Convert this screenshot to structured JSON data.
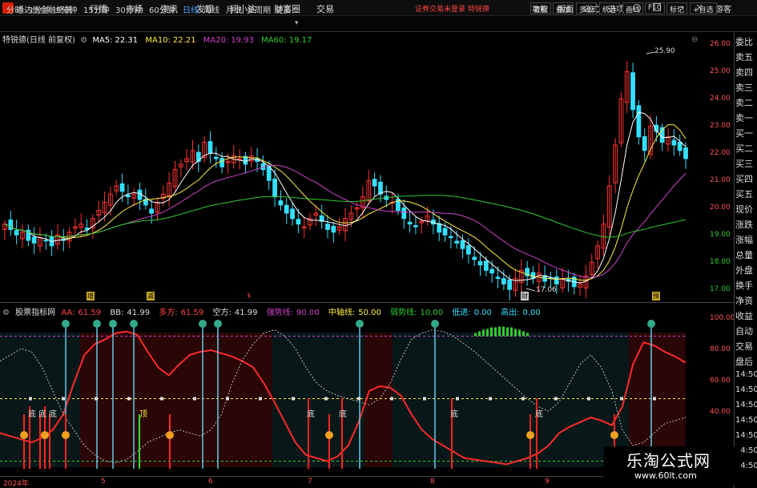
{
  "titlebar": {
    "app_name": "通达信金融终端",
    "menus": [
      "行情",
      "市场",
      "资讯",
      "发现",
      "问小达",
      "财富圈",
      "交易"
    ],
    "warning": "证券交易未登录  特锐德",
    "right_menus": [
      "功能",
      "版面",
      "公式",
      "选项"
    ],
    "guest": "游客"
  },
  "periodbar": {
    "tabs": [
      "分时",
      "1分钟",
      "5分钟",
      "15分钟",
      "30分钟",
      "60分钟",
      "日线",
      "周线",
      "月线",
      "多周期",
      "更多"
    ],
    "active": "日线",
    "tools": [
      "复权",
      "叠加",
      "多股",
      "统计",
      "画线",
      "F10",
      "标记",
      "+自选"
    ]
  },
  "chart_info": {
    "stock": "特锐德(日线 前复权)",
    "ma5_label": "MA5:",
    "ma5": "22.31",
    "ma10_label": "MA10:",
    "ma10": "22.21",
    "ma20_label": "MA20:",
    "ma20": "19.93",
    "ma60_label": "MA60:",
    "ma60": "19.17"
  },
  "price_axis": [
    "26.00",
    "25.00",
    "24.00",
    "23.00",
    "22.00",
    "21.00",
    "20.00",
    "19.00",
    "18.00",
    "17.00"
  ],
  "annotations": {
    "high": "25.90",
    "low": "17.06",
    "markers": [
      "增",
      "减",
      "$",
      "财",
      "预"
    ]
  },
  "right_side": [
    "委比",
    "卖五",
    "卖四",
    "卖三",
    "卖二",
    "卖一",
    "买一",
    "买二",
    "买三",
    "买四",
    "买五",
    "现价",
    "涨跌",
    "涨幅",
    "总量",
    "外盘",
    "换手",
    "净资",
    "收益",
    "自动",
    "交易",
    "盘后",
    "14:50",
    "14:50",
    "14:50",
    "14:50",
    "14:50",
    "14:50",
    "14:50"
  ],
  "indicator": {
    "name": "股票指标网",
    "aa_label": "AA:",
    "aa": "61.59",
    "bb_label": "BB:",
    "bb": "41.99",
    "duo_label": "多方:",
    "duo": "61.59",
    "kong_label": "空方:",
    "kong": "41.99",
    "strong_label": "强势线:",
    "strong": "90.00",
    "mid_label": "中轴线:",
    "mid": "50.00",
    "weak_label": "弱势线:",
    "weak": "10.00",
    "low_label": "低进:",
    "low": "0.00",
    "high_label": "高出:",
    "high": "0.00",
    "axis": [
      "100.00",
      "80.00",
      "60.00",
      "40.00"
    ],
    "bottom_label": "底",
    "top_label": "顶"
  },
  "date_axis": [
    "2024年",
    "5",
    "6",
    "7",
    "8",
    "9"
  ],
  "watermark": {
    "title": "乐淘公式网",
    "url": "www.60lt.com"
  },
  "colors": {
    "up": "#ff3333",
    "down": "#33e0ff",
    "ma5": "#ffffff",
    "ma10": "#ffee44",
    "ma20": "#cc44cc",
    "ma60": "#33cc33"
  }
}
